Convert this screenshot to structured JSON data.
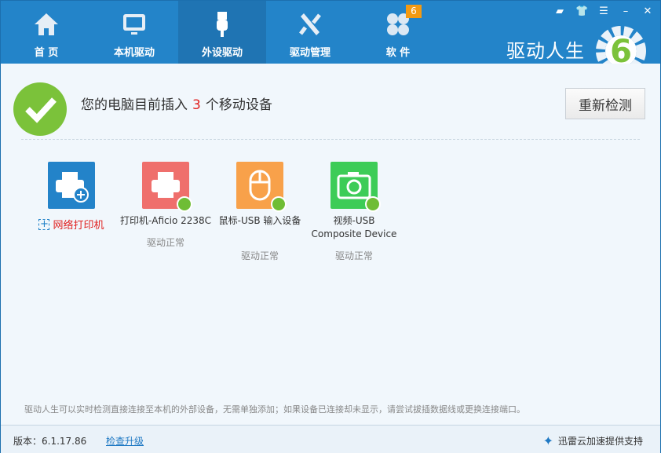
{
  "tabs": [
    {
      "label": "首 页",
      "icon": "home-icon"
    },
    {
      "label": "本机驱动",
      "icon": "monitor-icon"
    },
    {
      "label": "外设驱动",
      "icon": "usb-icon",
      "active": true
    },
    {
      "label": "驱动管理",
      "icon": "tools-icon"
    },
    {
      "label": "软 件",
      "icon": "clover-icon",
      "badge": "6"
    }
  ],
  "brand": {
    "name": "驱动人生",
    "logo_text": "6"
  },
  "status": {
    "prefix": "您的电脑目前插入",
    "count": "3",
    "suffix": "个移动设备"
  },
  "rescan_label": "重新检测",
  "add_printer_label": "网络打印机",
  "devices": [
    {
      "name": "打印机-Aficio 2238C",
      "status": "驱动正常",
      "color": "#ef6f6c",
      "icon": "printer-icon"
    },
    {
      "name": "鼠标-USB 输入设备",
      "status": "驱动正常",
      "color": "#f8a14a",
      "icon": "mouse-icon"
    },
    {
      "name": "视频-USB Composite Device",
      "status": "驱动正常",
      "color": "#3dcc57",
      "icon": "camera-icon"
    }
  ],
  "hint": "驱动人生可以实时检测直接连接至本机的外部设备，无需单独添加；如果设备已连接却未显示，请尝试拔插数据线或更换连接端口。",
  "footer": {
    "version": "版本：6.1.17.86",
    "upgrade": "检查升级",
    "support": "迅雷云加速提供支持"
  },
  "colors": {
    "header": "#2384c9",
    "accent": "#7bc23a"
  }
}
